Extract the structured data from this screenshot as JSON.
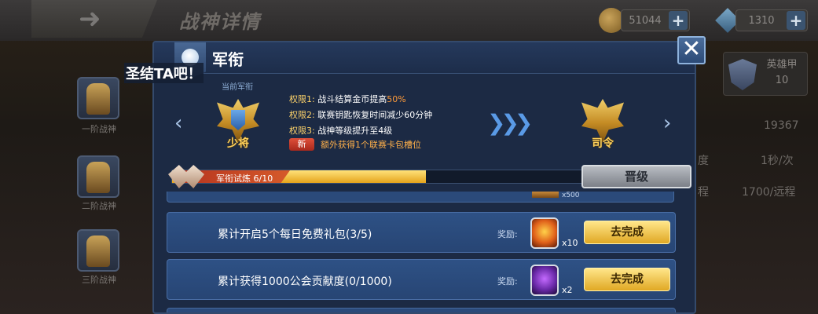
{
  "background": {
    "title": "战神详情",
    "gold_amount": "51044",
    "gem_amount": "1310",
    "side_ranks": [
      {
        "label": "一阶战神"
      },
      {
        "label": "二阶战神"
      },
      {
        "label": "三阶战神"
      }
    ],
    "armor": {
      "label": "英雄甲",
      "value": "10"
    },
    "right_stats": [
      "19367",
      "1秒/次",
      "1700/远程"
    ],
    "right_partial": [
      "度",
      "程"
    ]
  },
  "overlay_text": "圣结TA吧！",
  "dialog": {
    "title": "军衔",
    "current_label": "当前军衔",
    "current_rank": "少将",
    "next_rank": "司令",
    "privileges": [
      {
        "key": "权限1:",
        "text": "战斗结算金币提高",
        "highlight": "50%"
      },
      {
        "key": "权限2:",
        "text": "联赛钥匙恢复时间减少60分钟",
        "highlight": ""
      },
      {
        "key": "权限3:",
        "text": "战神等级提升至4级",
        "highlight": ""
      }
    ],
    "new_badge": "新",
    "new_privilege": "额外获得1个联赛卡包槽位",
    "progress": {
      "label": "军衔试炼 6/10",
      "current": 6,
      "total": 10
    },
    "promote_label": "晋级",
    "partial_count": "x500",
    "tasks": [
      {
        "name": "累计开启5个每日免费礼包(3/5)",
        "reward_label": "奖励:",
        "reward_icon": "fire-chest-icon",
        "reward_count": "x10",
        "button": "去完成"
      },
      {
        "name": "累计获得1000公会贡献度(0/1000)",
        "reward_label": "奖励:",
        "reward_icon": "mask-hero-icon",
        "reward_count": "x2",
        "button": "去完成"
      }
    ]
  },
  "colors": {
    "dialog_bg": "#1c2a44",
    "task_row": "#2e5185",
    "gold_button": "#e0a824",
    "progress_fill": "#e5a41c",
    "rank_gold": "#ffd15a"
  }
}
